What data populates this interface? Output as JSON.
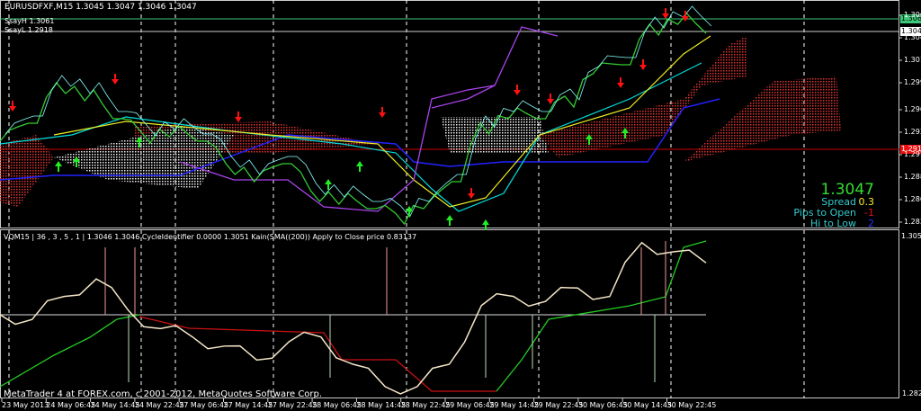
{
  "header": {
    "symbol_line": "EURUSDFXF,M15  1.3045 1.3047 1.3046 1.3047",
    "swing_high": "SsayH 1.3061",
    "swing_low": "SsayL 1.2918"
  },
  "indicator_header": "VQM15 | 36 , 3 , 5 , 1 | 1.3046 1.3046  CycleIdentifier 0.0000 1.3051  Kain(SMA((200)) Apply to Close price 0.83137",
  "copyright": "MetaTrader 4 at FOREX.com, c 2001-2012, MetaQuotes Software Corp.",
  "info_panel": {
    "price": "1.3047",
    "spread_label": "Spread",
    "spread_value": "0.3",
    "pips_label": "Pips to Open",
    "pips_value": "-1",
    "hilo_label": "Hi to Low",
    "hilo_value": "2"
  },
  "price_tags": {
    "high": "1.3061",
    "current": "1.3047",
    "low": "1.2918"
  },
  "colors": {
    "up": "#00ff00",
    "down": "#ff0000",
    "line_high": "#3cc878",
    "line_low": "#cc0000",
    "bg": "#000000"
  },
  "chart_data": [
    {
      "type": "line",
      "title": "EURUSDFXF,M15",
      "yticks": [
        "1.3065",
        "1.3040",
        "1.3015",
        "1.2990",
        "1.2960",
        "1.2935",
        "1.2910",
        "1.2885",
        "1.2860",
        "1.2835"
      ],
      "ylim": [
        1.2835,
        1.3065
      ],
      "xticks": [
        "23 May 2013",
        "24 May 06:45",
        "24 May 14:45",
        "24 May 22:45",
        "27 May 06:45",
        "27 May 14:45",
        "27 May 22:45",
        "28 May 06:45",
        "28 May 14:45",
        "28 May 22:45",
        "29 May 06:45",
        "29 May 14:45",
        "29 May 22:45",
        "30 May 06:45",
        "30 May 14:45",
        "30 May 22:45"
      ],
      "close": [
        1.2925,
        1.2945,
        1.299,
        1.297,
        1.295,
        1.2935,
        1.293,
        1.2925,
        1.29,
        1.288,
        1.29,
        1.287,
        1.2855,
        1.285,
        1.2845,
        1.285,
        1.288,
        1.2945,
        1.295,
        1.295,
        1.2975,
        1.3,
        1.301,
        1.3055,
        1.3055,
        1.3045
      ],
      "levels": {
        "swing_high": 1.3061,
        "current": 1.3047,
        "swing_low": 1.2918
      }
    },
    {
      "type": "line",
      "title": "VQM15",
      "yticks": [
        "1.3056",
        "1.2827"
      ],
      "ylim": [
        1.2827,
        1.3056
      ],
      "values": [
        1.2943,
        1.2936,
        1.2969,
        1.2994,
        1.2949,
        1.2923,
        1.2911,
        1.2898,
        1.2878,
        1.2904,
        1.2911,
        1.2872,
        1.284,
        1.284,
        1.2872,
        1.2956,
        1.2969,
        1.2962,
        1.2981,
        1.2969,
        1.3046,
        1.3033,
        1.3017
      ]
    }
  ]
}
